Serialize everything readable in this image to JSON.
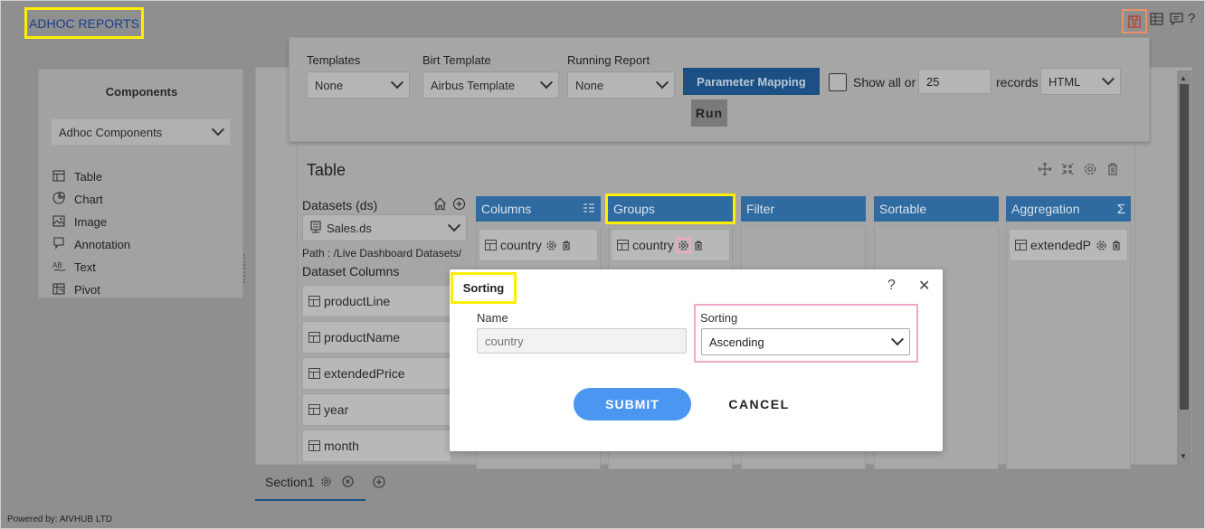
{
  "header": {
    "title": "ADHOC REPORTS",
    "help_glyph": "?"
  },
  "components_panel": {
    "title": "Components",
    "dropdown_value": "Adhoc Components",
    "items": [
      {
        "label": "Table",
        "icon": "table-icon"
      },
      {
        "label": "Chart",
        "icon": "chart-icon"
      },
      {
        "label": "Image",
        "icon": "image-icon"
      },
      {
        "label": "Annotation",
        "icon": "annotation-icon"
      },
      {
        "label": "Text",
        "icon": "text-icon"
      },
      {
        "label": "Pivot",
        "icon": "pivot-icon"
      }
    ]
  },
  "toolbar": {
    "templates_label": "Templates",
    "templates_value": "None",
    "birt_label": "Birt Template",
    "birt_value": "Airbus Template",
    "running_label": "Running Report",
    "running_value": "None",
    "param_mapping": "Parameter Mapping",
    "show_all": "Show all or",
    "records_value": "25",
    "records_label": "records",
    "format_value": "HTML",
    "run": "Run"
  },
  "table_widget": {
    "title": "Table",
    "datasets_label": "Datasets (ds)",
    "dataset_value": "Sales.ds",
    "path": "Path : /Live Dashboard Datasets/",
    "dataset_columns_label": "Dataset Columns",
    "dataset_columns": [
      "productLine",
      "productName",
      "extendedPrice",
      "year",
      "month"
    ],
    "columns": [
      {
        "header": "Columns",
        "items": [
          "country"
        ]
      },
      {
        "header": "Groups",
        "items": [
          "country"
        ]
      },
      {
        "header": "Filter",
        "items": []
      },
      {
        "header": "Sortable",
        "items": []
      },
      {
        "header": "Aggregation",
        "items": [
          "extendedPı"
        ]
      }
    ],
    "sigma": "Σ"
  },
  "section_tabs": [
    {
      "label": "Section1"
    }
  ],
  "footer": "Powered by: AIVHUB LTD",
  "dialog": {
    "title": "Sorting",
    "help": "?",
    "close": "✕",
    "name_label": "Name",
    "name_placeholder": "country",
    "sorting_label": "Sorting",
    "sorting_value": "Ascending",
    "submit": "SUBMIT",
    "cancel": "CANCEL"
  },
  "colors": {
    "accent": "#2f6aa0",
    "submit": "#4a96f0",
    "highlight_yellow": "#ffee00",
    "highlight_pink": "#f0a8c8"
  }
}
